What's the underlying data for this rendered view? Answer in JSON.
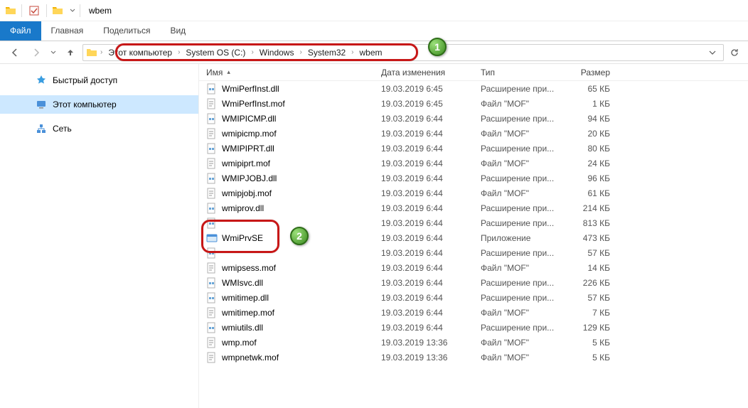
{
  "titlebar": {
    "title": "wbem"
  },
  "ribbon": {
    "file": "Файл",
    "tabs": [
      "Главная",
      "Поделиться",
      "Вид"
    ]
  },
  "breadcrumbs": [
    "Этот компьютер",
    "System OS (C:)",
    "Windows",
    "System32",
    "wbem"
  ],
  "sidebar": {
    "quick": "Быстрый доступ",
    "thispc": "Этот компьютер",
    "network": "Сеть"
  },
  "columns": {
    "name": "Имя",
    "date": "Дата изменения",
    "type": "Тип",
    "size": "Размер"
  },
  "files": [
    {
      "name": "WmiPerfInst.dll",
      "date": "19.03.2019 6:45",
      "type": "Расширение при...",
      "size": "65 КБ",
      "icon": "dll"
    },
    {
      "name": "WmiPerfInst.mof",
      "date": "19.03.2019 6:45",
      "type": "Файл \"MOF\"",
      "size": "1 КБ",
      "icon": "mof"
    },
    {
      "name": "WMIPICMP.dll",
      "date": "19.03.2019 6:44",
      "type": "Расширение при...",
      "size": "94 КБ",
      "icon": "dll"
    },
    {
      "name": "wmipicmp.mof",
      "date": "19.03.2019 6:44",
      "type": "Файл \"MOF\"",
      "size": "20 КБ",
      "icon": "mof"
    },
    {
      "name": "WMIPIPRT.dll",
      "date": "19.03.2019 6:44",
      "type": "Расширение при...",
      "size": "80 КБ",
      "icon": "dll"
    },
    {
      "name": "wmipiprt.mof",
      "date": "19.03.2019 6:44",
      "type": "Файл \"MOF\"",
      "size": "24 КБ",
      "icon": "mof"
    },
    {
      "name": "WMIPJOBJ.dll",
      "date": "19.03.2019 6:44",
      "type": "Расширение при...",
      "size": "96 КБ",
      "icon": "dll"
    },
    {
      "name": "wmipjobj.mof",
      "date": "19.03.2019 6:44",
      "type": "Файл \"MOF\"",
      "size": "61 КБ",
      "icon": "mof"
    },
    {
      "name": "wmiprov.dll",
      "date": "19.03.2019 6:44",
      "type": "Расширение при...",
      "size": "214 КБ",
      "icon": "dll"
    },
    {
      "name": "",
      "date": "19.03.2019 6:44",
      "type": "Расширение при...",
      "size": "813 КБ",
      "icon": "dll"
    },
    {
      "name": "WmiPrvSE",
      "date": "19.03.2019 6:44",
      "type": "Приложение",
      "size": "473 КБ",
      "icon": "exe"
    },
    {
      "name": "",
      "date": "19.03.2019 6:44",
      "type": "Расширение при...",
      "size": "57 КБ",
      "icon": "dll"
    },
    {
      "name": "wmipsess.mof",
      "date": "19.03.2019 6:44",
      "type": "Файл \"MOF\"",
      "size": "14 КБ",
      "icon": "mof"
    },
    {
      "name": "WMIsvc.dll",
      "date": "19.03.2019 6:44",
      "type": "Расширение при...",
      "size": "226 КБ",
      "icon": "dll"
    },
    {
      "name": "wmitimep.dll",
      "date": "19.03.2019 6:44",
      "type": "Расширение при...",
      "size": "57 КБ",
      "icon": "dll"
    },
    {
      "name": "wmitimep.mof",
      "date": "19.03.2019 6:44",
      "type": "Файл \"MOF\"",
      "size": "7 КБ",
      "icon": "mof"
    },
    {
      "name": "wmiutils.dll",
      "date": "19.03.2019 6:44",
      "type": "Расширение при...",
      "size": "129 КБ",
      "icon": "dll"
    },
    {
      "name": "wmp.mof",
      "date": "19.03.2019 13:36",
      "type": "Файл \"MOF\"",
      "size": "5 КБ",
      "icon": "mof"
    },
    {
      "name": "wmpnetwk.mof",
      "date": "19.03.2019 13:36",
      "type": "Файл \"MOF\"",
      "size": "5 КБ",
      "icon": "mof"
    }
  ],
  "callouts": {
    "one": "1",
    "two": "2"
  }
}
